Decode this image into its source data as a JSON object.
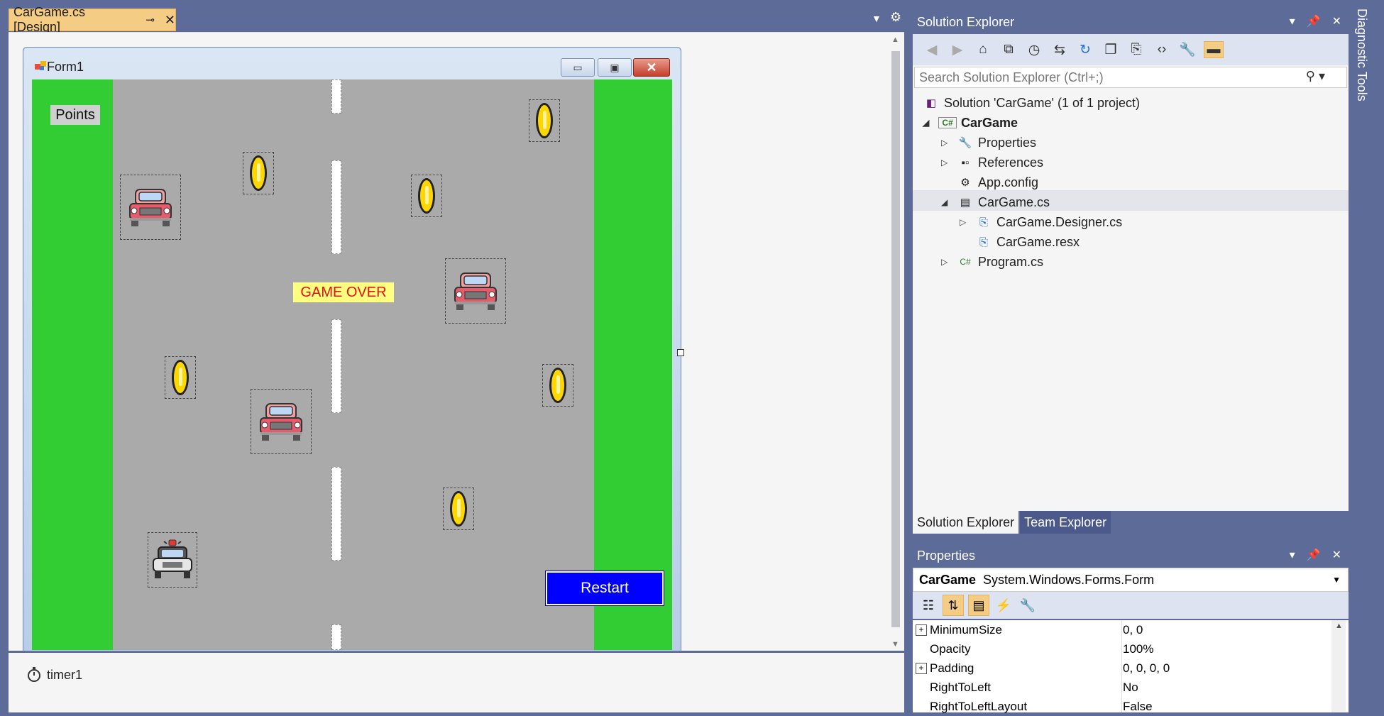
{
  "document_tab": {
    "title": "CarGame.cs [Design]",
    "pin": "⊸",
    "close": "✕"
  },
  "form": {
    "title": "Form1",
    "min": "▭",
    "max": "▣",
    "close": "✕",
    "points_label": "Points",
    "gameover_label": "GAME OVER",
    "restart_label": "Restart"
  },
  "tray": {
    "timer_label": "timer1"
  },
  "solution_explorer": {
    "title": "Solution Explorer",
    "search_placeholder": "Search Solution Explorer (Ctrl+;)",
    "tree": [
      {
        "label": "Solution 'CarGame' (1 of 1 project)",
        "icon": "solution-icon"
      },
      {
        "label": "CarGame",
        "icon": "csharp-project-icon",
        "bold": true
      },
      {
        "label": "Properties",
        "icon": "wrench-icon"
      },
      {
        "label": "References",
        "icon": "references-icon"
      },
      {
        "label": "App.config",
        "icon": "config-file-icon"
      },
      {
        "label": "CarGame.cs",
        "icon": "form-file-icon",
        "selected": true
      },
      {
        "label": "CarGame.Designer.cs",
        "icon": "designer-file-icon"
      },
      {
        "label": "CarGame.resx",
        "icon": "resx-file-icon"
      },
      {
        "label": "Program.cs",
        "icon": "csharp-file-icon"
      }
    ],
    "tabs": [
      "Solution Explorer",
      "Team Explorer"
    ]
  },
  "properties": {
    "title": "Properties",
    "object_name": "CarGame",
    "object_type": "System.Windows.Forms.Form",
    "rows": [
      {
        "name": "MinimumSize",
        "value": "0, 0",
        "expandable": true
      },
      {
        "name": "Opacity",
        "value": "100%",
        "expandable": false
      },
      {
        "name": "Padding",
        "value": "0, 0, 0, 0",
        "expandable": true
      },
      {
        "name": "RightToLeft",
        "value": "No",
        "expandable": false
      },
      {
        "name": "RightToLeftLayout",
        "value": "False",
        "expandable": false
      }
    ]
  },
  "side_tab": {
    "label": "Diagnostic Tools"
  },
  "colors": {
    "grass": "#32cd32",
    "road": "#aaaaaa",
    "restart_bg": "#0000ff",
    "gameover_text": "#e01010",
    "tab_active": "#f5cc84",
    "chrome": "#5d6b99"
  }
}
